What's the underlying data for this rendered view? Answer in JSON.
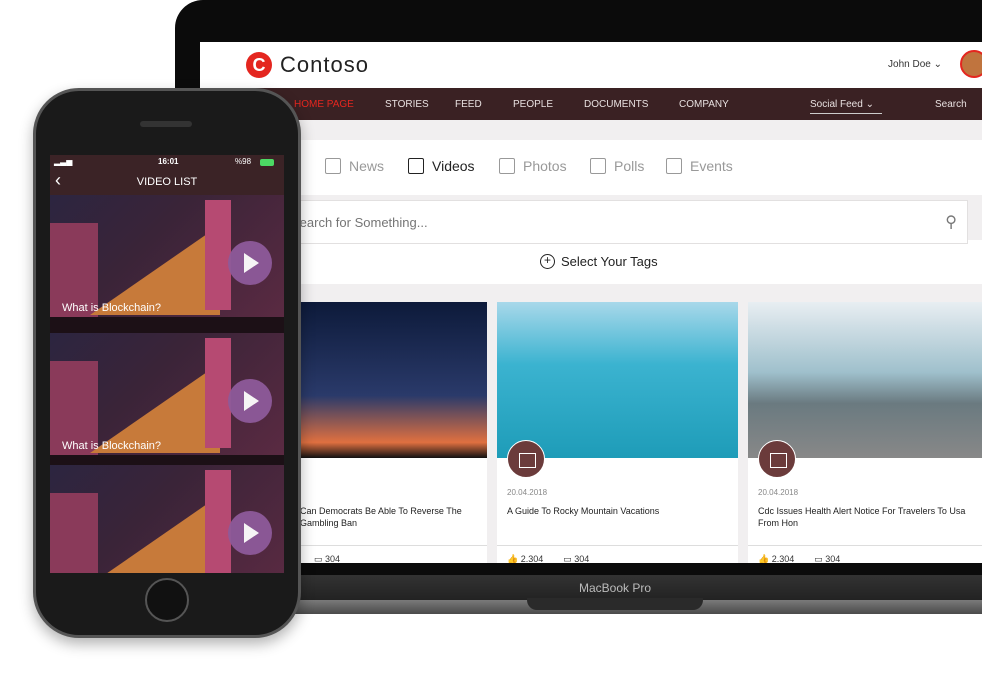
{
  "laptop": {
    "brand_label": "MacBook Pro",
    "header": {
      "logo_text": "Contoso",
      "user_name": "John Doe"
    },
    "nav": {
      "items": [
        "HOME PAGE",
        "STORIES",
        "FEED",
        "PEOPLE",
        "DOCUMENTS",
        "COMPANY"
      ],
      "active": "HOME PAGE",
      "social_feed": "Social Feed",
      "search": "Search"
    },
    "tabs": [
      "News",
      "Videos",
      "Photos",
      "Polls",
      "Events"
    ],
    "active_tab": "Videos",
    "search_placeholder": "Search for Something...",
    "select_tags": "Select Your Tags",
    "cards": [
      {
        "date": "",
        "title": "Can Democrats Be Able To Reverse The Gambling Ban",
        "likes": "",
        "comments": "304"
      },
      {
        "date": "20.04.2018",
        "title": "A Guide To Rocky Mountain Vacations",
        "likes": "2.304",
        "comments": "304"
      },
      {
        "date": "20.04.2018",
        "title": "Cdc Issues Health Alert Notice For Travelers To Usa From Hon",
        "likes": "2.304",
        "comments": "304"
      }
    ]
  },
  "phone": {
    "time": "16:01",
    "battery": "%98",
    "title": "VIDEO LIST",
    "videos": [
      {
        "title": "What is Blockchain?"
      },
      {
        "title": "What is Blockchain?"
      },
      {
        "title": ""
      }
    ]
  },
  "colors": {
    "nav_bg": "#3a2123",
    "accent": "#e4261f",
    "play": "#8e5a9a"
  }
}
